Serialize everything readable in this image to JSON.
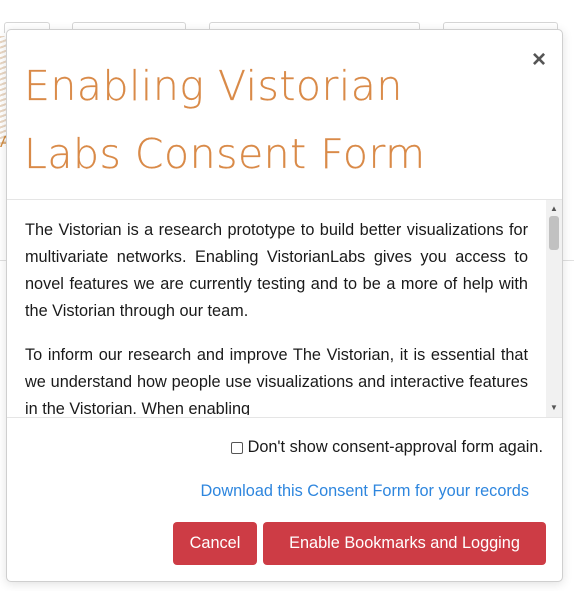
{
  "modal": {
    "title": "Enabling Vistorian Labs Consent Form",
    "close_symbol": "×",
    "paragraphs": [
      "The Vistorian is a research prototype to build better visualizations for multivariate networks. Enabling VistorianLabs gives you access to novel features we are currently testing and to be a more of help with the Vistorian through our team.",
      "To inform our research and improve The Vistorian, it is essential that we understand how people use visualizations and interactive features in the Vistorian. When enabling"
    ],
    "checkbox_label": "Don't show consent-approval form again.",
    "checkbox_checked": false,
    "download_link": "Download this Consent Form for your records",
    "cancel_label": "Cancel",
    "enable_label": "Enable Bookmarks and Logging"
  },
  "colors": {
    "title": "#d98a48",
    "button": "#cd3c45",
    "link": "#2e86de"
  },
  "icons": {
    "close": "close-icon",
    "scroll_up": "scroll-up-arrow-icon",
    "scroll_down": "scroll-down-arrow-icon"
  }
}
